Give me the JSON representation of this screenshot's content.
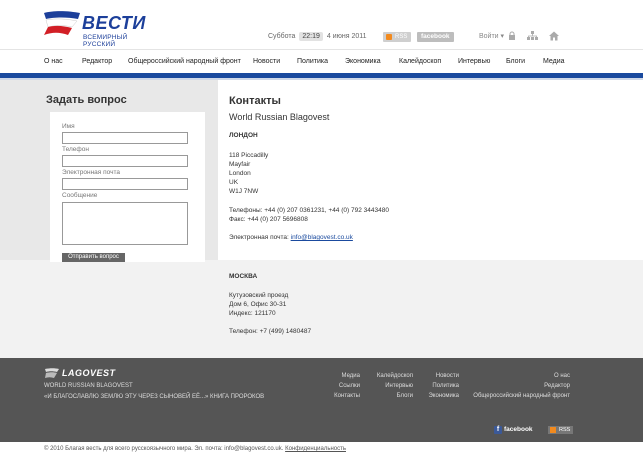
{
  "header": {
    "logo_word": "ВЕСТИ",
    "logo_sub": "ВСЕМИРНЫЙ РУССКИЙ",
    "day": "Суббота",
    "time": "22:19",
    "date": "4 июня 2011",
    "rss_label": "RSS",
    "facebook_label": "facebook",
    "login_label": "Войти ▾"
  },
  "nav": {
    "items": [
      "О нас",
      "Редактор",
      "Общероссийский народный фронт",
      "Новости",
      "Политика",
      "Экономика",
      "Калейдоскоп",
      "Интервью",
      "Блоги",
      "Медиа"
    ]
  },
  "form": {
    "title": "Задать вопрос",
    "name_label": "Имя",
    "phone_label": "Телефон",
    "email_label": "Электронная почта",
    "message_label": "Сообщение",
    "name_value": "",
    "phone_value": "",
    "email_value": "",
    "message_value": "",
    "submit_label": "Отправить вопрос"
  },
  "contacts": {
    "title": "Контакты",
    "org": "World Russian Blagovest",
    "london": {
      "heading": "ЛОНДОН",
      "address": [
        "118 Piccadilly",
        "Mayfair",
        "London",
        "UK",
        "W1J 7NW"
      ],
      "phones": "Телефоны: +44 (0) 207 0361231, +44 (0) 792 3443480",
      "fax": "Факс: +44 (0) 207 5696808",
      "email_label": "Электронная почта:",
      "email": "info@blagovest.co.uk"
    },
    "moscow": {
      "heading": "МОСКВА",
      "address": [
        "Кутузовский проезд",
        "Дом 6, Офис 30-31",
        "Индекс: 121170"
      ],
      "phone": "Телефон: +7 (499) 1480487"
    }
  },
  "footer": {
    "logo_word": "LAGOVEST",
    "org": "WORLD RUSSIAN BLAGOVEST",
    "motto": "«И БЛАГОСЛАВЛЮ ЗЕМЛЮ ЭТУ ЧЕРЕЗ СЫНОВЕЙ ЕЁ...» КНИГА ПРОРОКОВ",
    "col1": [
      "Медиа",
      "Ссылки",
      "Контакты"
    ],
    "col2": [
      "Калейдоскоп",
      "Интервью",
      "Блоги"
    ],
    "col3": [
      "Новости",
      "Политика",
      "Экономика"
    ],
    "col4": [
      "О нас",
      "Редактор",
      "Общероссийский народный фронт"
    ],
    "facebook_label": "facebook",
    "rss_label": "RSS",
    "copyright": "© 2010 Благая весть для всего русскоязычного мира. Эл. почта: info@blagovest.co.uk.",
    "privacy": "Конфиденциальность"
  },
  "colors": {
    "brand_blue": "#1a4a9e",
    "brand_red": "#d21f26",
    "footer_bg": "#555555"
  }
}
